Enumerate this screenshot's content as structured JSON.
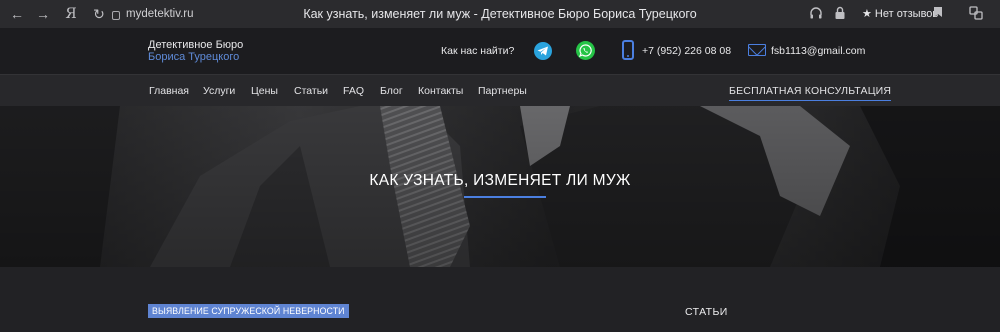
{
  "browser": {
    "url": "mydetektiv.ru",
    "yandex_glyph": "Я",
    "tab_title": "Как узнать, изменяет ли муж - Детективное Бюро Бориса Турецкого",
    "reviews_label": "★ Нет отзывов"
  },
  "header": {
    "brand_line1": "Детективное Бюро",
    "brand_line2": "Бориса Турецкого",
    "find_us": "Как нас найти?",
    "phone": "+7 (952) 226 08 08",
    "email": "fsb1113@gmail.com"
  },
  "menu": {
    "items": [
      "Главная",
      "Услуги",
      "Цены",
      "Статьи",
      "FAQ",
      "Блог",
      "Контакты",
      "Партнеры"
    ],
    "cta": "БЕСПЛАТНАЯ КОНСУЛЬТАЦИЯ"
  },
  "hero": {
    "title": "КАК УЗНАТЬ, ИЗМЕНЯЕТ ЛИ МУЖ"
  },
  "content": {
    "category_tag": "ВЫЯВЛЕНИЕ СУПРУЖЕСКОЙ НЕВЕРНОСТИ",
    "sidebar_title": "СТАТЬИ"
  },
  "colors": {
    "accent": "#4b7fe0",
    "brand_blue": "#5f8bd8",
    "telegram": "#2aa3dd",
    "whatsapp": "#25c446"
  }
}
